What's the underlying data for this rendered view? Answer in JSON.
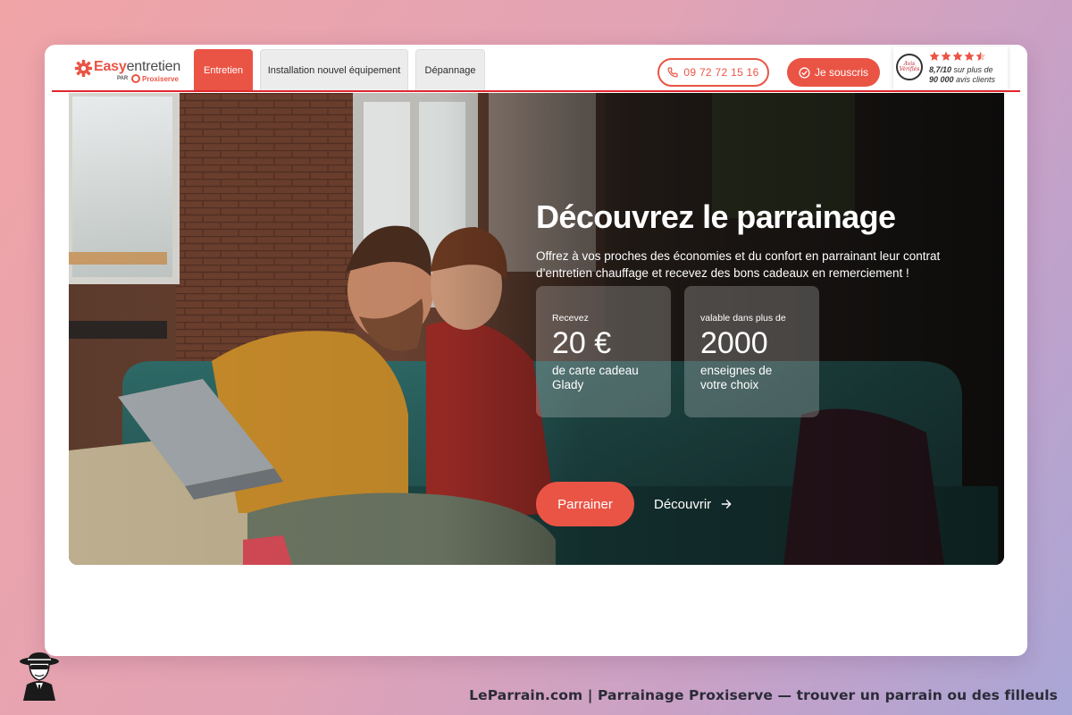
{
  "brand": {
    "name_part1": "Easy",
    "name_part2": "entretien",
    "by_label": "PAR",
    "partner": "Proxiserve",
    "accent_color": "#ea5445",
    "logo_icon": "gear-icon"
  },
  "nav": {
    "tabs": [
      {
        "label": "Entretien",
        "active": true
      },
      {
        "label": "Installation nouvel équipement",
        "active": false
      },
      {
        "label": "Dépannage",
        "active": false
      }
    ]
  },
  "header": {
    "phone": {
      "label": "09 72 72 15 16",
      "icon": "phone-icon"
    },
    "subscribe": {
      "label": "Je souscris",
      "icon": "check-circle-icon"
    },
    "reviews": {
      "badge_line1": "Avis",
      "badge_line2": "Vérifiés",
      "stars": "★★★★★",
      "rating_value": 4.5,
      "score": "8,7/10",
      "text_middle": " sur plus de",
      "count": "90 000",
      "text_end": " avis clients"
    }
  },
  "hero": {
    "title": "Découvrez le parrainage",
    "description": "Offrez à vos proches des économies et du confort en parrainant leur contrat d’entretien chauffage et recevez des bons cadeaux en remerciement !",
    "cards": [
      {
        "label": "Recevez",
        "value": "20 €",
        "desc_line1": "de carte cadeau",
        "desc_line2": "Glady"
      },
      {
        "label": "valable dans plus de",
        "value": "2000",
        "desc_line1": "enseignes de",
        "desc_line2": "votre choix"
      }
    ],
    "cta_primary": "Parrainer",
    "cta_secondary": "Découvrir",
    "cta_secondary_icon": "arrow-right-icon"
  },
  "footer": {
    "caption": "LeParrain.com | Parrainage Proxiserve — trouver un parrain ou des filleuls",
    "mascot_icon": "spy-mascot-icon"
  }
}
